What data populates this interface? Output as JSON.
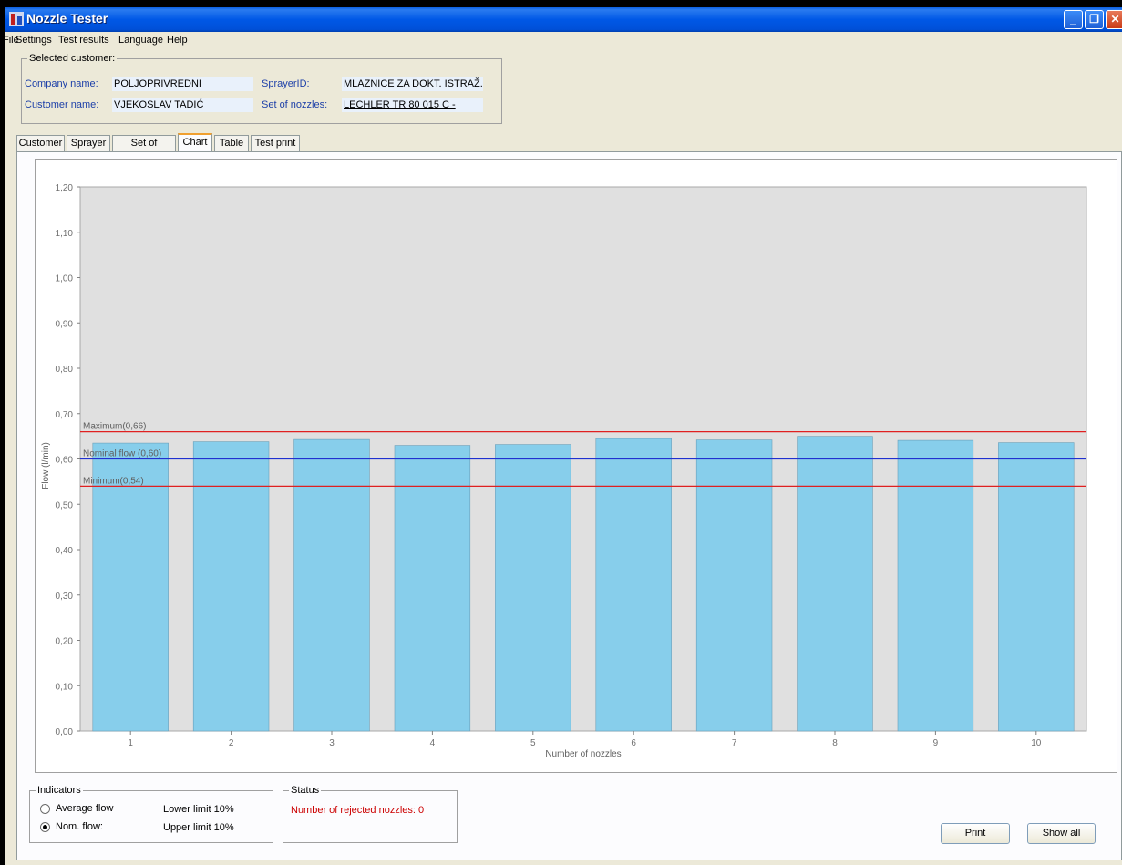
{
  "window": {
    "title": "Nozzle Tester"
  },
  "menu": [
    "File",
    "Settings",
    "Test results",
    "Language",
    "Help"
  ],
  "customer": {
    "legend": "Selected customer:",
    "company_label": "Company name:",
    "company_value": "POLJOPRIVREDNI FAKULTET",
    "customer_label": "Customer name:",
    "customer_value": "VJEKOSLAV TADIĆ",
    "sprayer_label": "SprayerID:",
    "sprayer_value": "MLAZNICE ZA DOKT. ISTRAŽ.",
    "nozzles_label": "Set of nozzles:",
    "nozzles_value": "LECHLER TR 80 015 C -"
  },
  "tabs": [
    "Customer",
    "Sprayer",
    "Set of nozzles",
    "Chart",
    "Table",
    "Test print"
  ],
  "active_tab": "Chart",
  "chart_data": {
    "type": "bar",
    "categories": [
      "1",
      "2",
      "3",
      "4",
      "5",
      "6",
      "7",
      "8",
      "9",
      "10"
    ],
    "values": [
      0.635,
      0.638,
      0.643,
      0.63,
      0.632,
      0.645,
      0.642,
      0.65,
      0.641,
      0.636
    ],
    "xlabel": "Number of nozzles",
    "ylabel": "Flow  (l/min)",
    "ylim": [
      0,
      1.2
    ],
    "yticks": [
      "0,00",
      "0,10",
      "0,20",
      "0,30",
      "0,40",
      "0,50",
      "0,60",
      "0,70",
      "0,80",
      "0,90",
      "1,00",
      "1,10",
      "1,20"
    ],
    "reference_lines": [
      {
        "label": "Maximum(0,66)",
        "value": 0.66,
        "color": "#e02020"
      },
      {
        "label": "Nominal flow (0,60)",
        "value": 0.6,
        "color": "#2030d0"
      },
      {
        "label": "Minimum(0,54)",
        "value": 0.54,
        "color": "#e02020"
      }
    ],
    "bar_color": "#87ceeb",
    "plot_background": "#e0e0e0"
  },
  "indicators": {
    "legend": "Indicators",
    "average_label": "Average flow",
    "nominal_label": "Nom. flow:",
    "selected": "Nom. flow:",
    "lower_limit": "Lower limit 10%",
    "upper_limit": "Upper limit 10%"
  },
  "status": {
    "legend": "Status",
    "rejected_text": "Number of rejected nozzles: 0",
    "rejected_color": "#cc0000"
  },
  "buttons": {
    "print": "Print",
    "show_all": "Show all"
  }
}
